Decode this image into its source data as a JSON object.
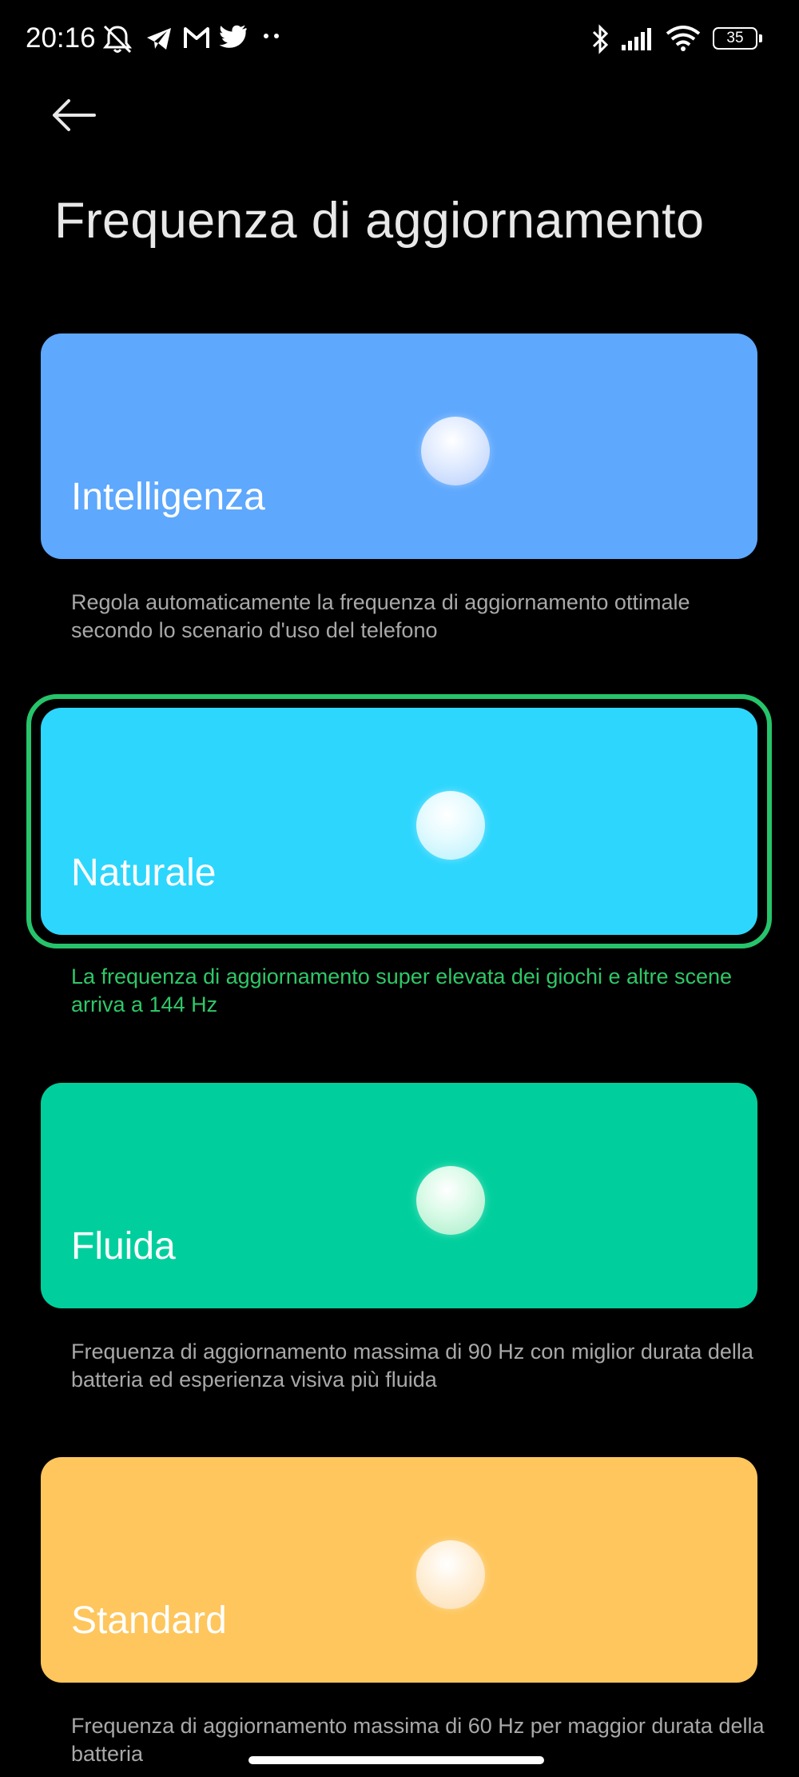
{
  "status_bar": {
    "time": "20:16",
    "battery_level": "35",
    "left_icons": [
      "mute-notifications-icon",
      "telegram-icon",
      "gmail-icon",
      "twitter-icon",
      "more-dots-icon"
    ],
    "right_icons": [
      "bluetooth-icon",
      "signal-icon",
      "wifi-icon",
      "battery-icon"
    ]
  },
  "header": {
    "back_icon": "arrow-left-icon",
    "title": "Frequenza di aggiornamento"
  },
  "modes": [
    {
      "label": "Intelligenza",
      "description": "Regola automaticamente la frequenza di aggiornamento ottimale secondo lo scenario d'uso del telefono",
      "color": "#5ea8fd",
      "selected": false
    },
    {
      "label": "Naturale",
      "description": "La frequenza di aggiornamento super elevata dei giochi e altre scene arriva a 144 Hz",
      "color": "#2dd6fd",
      "selected": true
    },
    {
      "label": "Fluida",
      "description": "Frequenza di aggiornamento massima di 90 Hz con miglior durata della batteria ed esperienza visiva più fluida",
      "color": "#00cf9d",
      "selected": false
    },
    {
      "label": "Standard",
      "description": "Frequenza di aggiornamento massima di 60 Hz per maggior durata della batteria",
      "color": "#fec65c",
      "selected": false
    }
  ],
  "accent_color": "#26c46b"
}
